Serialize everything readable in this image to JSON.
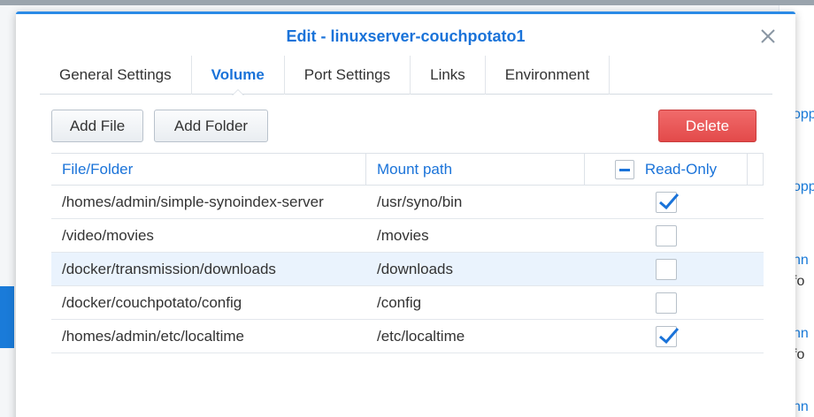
{
  "background": {
    "snippets": [
      "opp",
      "opp",
      "nn",
      "fo",
      "nn",
      "fo",
      "nn"
    ]
  },
  "dialog": {
    "title": "Edit - linuxserver-couchpotato1",
    "tabs": [
      {
        "label": "General Settings",
        "active": false
      },
      {
        "label": "Volume",
        "active": true
      },
      {
        "label": "Port Settings",
        "active": false
      },
      {
        "label": "Links",
        "active": false
      },
      {
        "label": "Environment",
        "active": false
      }
    ],
    "toolbar": {
      "add_file_label": "Add File",
      "add_folder_label": "Add Folder",
      "delete_label": "Delete"
    },
    "table": {
      "columns": [
        "File/Folder",
        "Mount path",
        "Read-Only"
      ],
      "rows": [
        {
          "file_folder": "/homes/admin/simple-synoindex-server",
          "mount_path": "/usr/syno/bin",
          "read_only": true
        },
        {
          "file_folder": "/video/movies",
          "mount_path": "/movies",
          "read_only": false
        },
        {
          "file_folder": "/docker/transmission/downloads",
          "mount_path": "/downloads",
          "read_only": false,
          "selected": true
        },
        {
          "file_folder": "/docker/couchpotato/config",
          "mount_path": "/config",
          "read_only": false
        },
        {
          "file_folder": "/homes/admin/etc/localtime",
          "mount_path": "/etc/localtime",
          "read_only": true
        }
      ]
    }
  },
  "colors": {
    "accent": "#1a73d9",
    "danger": "#e34a4a",
    "selected_row": "#eaf3fd"
  }
}
